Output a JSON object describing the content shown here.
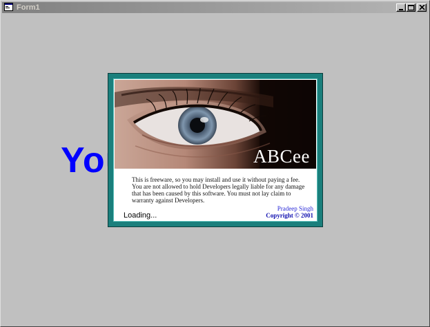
{
  "window": {
    "title": "Form1",
    "background_color": "#c0c0c0",
    "icons": {
      "app": "form-app-icon",
      "minimize": "minimize-icon",
      "maximize": "maximize-icon",
      "close": "close-icon"
    }
  },
  "main": {
    "background_text": "Your Software",
    "background_text_color": "#0000ff"
  },
  "splash": {
    "frame_color": "#1a7f7c",
    "image": "eye-photo",
    "product_name": "ABCee",
    "disclaimer_lines": [
      "This is freeware, so you may install and use it without paying a fee.",
      "You are not allowed to hold Developers legally liable for any damage",
      "that has been caused by this software. You must not lay claim to",
      "warranty against Developers."
    ],
    "author": "Pradeep Singh",
    "copyright": "Copyright © 2001",
    "status": "Loading..."
  }
}
